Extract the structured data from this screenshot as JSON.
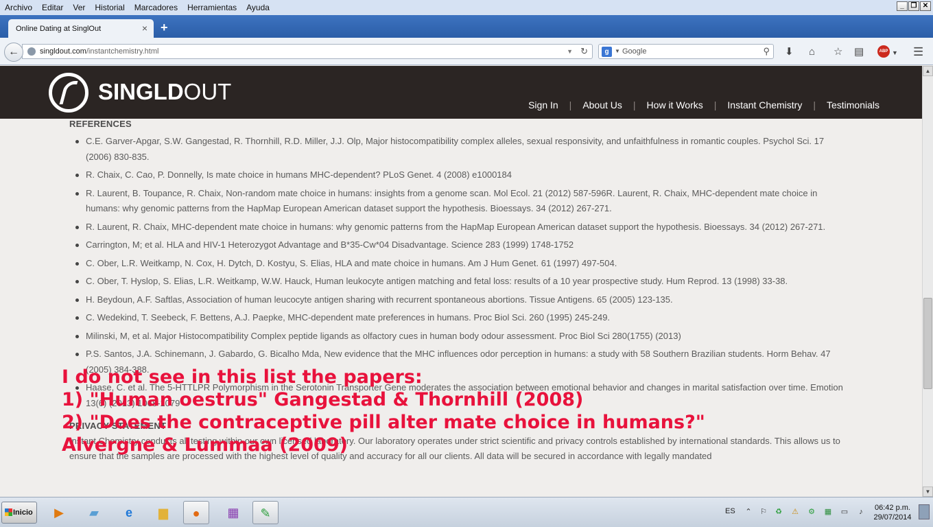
{
  "window": {
    "menu": [
      "Archivo",
      "Editar",
      "Ver",
      "Historial",
      "Marcadores",
      "Herramientas",
      "Ayuda"
    ],
    "controls": {
      "minimize": "_",
      "restore": "❐",
      "close": "✕"
    }
  },
  "tab": {
    "title": "Online Dating at SinglOut",
    "close_label": "×",
    "new_tab_label": "+"
  },
  "navbar": {
    "back_label": "←",
    "url_host": "singldout.com",
    "url_path": "/instantchemistry.html",
    "search_engine_label": "g",
    "search_placeholder": "Google",
    "icons": [
      "download-icon",
      "home-icon",
      "bookmark-star-icon",
      "reading-list-icon",
      "adblock-icon",
      "menu-icon"
    ],
    "abp_label": "ABP"
  },
  "site": {
    "logo_text_bold": "SINGLD",
    "logo_text_light": "OUT",
    "nav": [
      "Sign In",
      "About Us",
      "How it Works",
      "Instant Chemistry",
      "Testimonials"
    ],
    "separator": "|"
  },
  "content": {
    "references_title": "REFERENCES",
    "references": [
      "C.E. Garver-Apgar, S.W. Gangestad, R. Thornhill, R.D. Miller, J.J. Olp, Major histocompatibility complex alleles, sexual responsivity, and unfaithfulness in romantic couples. Psychol Sci. 17 (2006) 830-835.",
      "R. Chaix, C. Cao, P. Donnelly, Is mate choice in humans MHC-dependent? PLoS Genet. 4 (2008) e1000184",
      "R. Laurent, B. Toupance, R. Chaix, Non-random mate choice in humans: insights from a genome scan. Mol Ecol. 21 (2012) 587-596R. Laurent, R. Chaix, MHC-dependent mate choice in humans: why genomic patterns from the HapMap European American dataset support the hypothesis. Bioessays. 34 (2012) 267-271.",
      "R. Laurent, R. Chaix, MHC-dependent mate choice in humans: why genomic patterns from the HapMap European American dataset support the hypothesis. Bioessays. 34 (2012) 267-271.",
      "Carrington, M; et al. HLA and HIV-1 Heterozygot Advantage and B*35-Cw*04 Disadvantage. Science 283 (1999) 1748-1752",
      "C. Ober, L.R. Weitkamp, N. Cox, H. Dytch, D. Kostyu, S. Elias, HLA and mate choice in humans. Am J Hum Genet. 61 (1997) 497-504.",
      "C. Ober, T. Hyslop, S. Elias, L.R. Weitkamp, W.W. Hauck, Human leukocyte antigen matching and fetal loss: results of a 10 year prospective study. Hum Reprod. 13 (1998) 33-38.",
      "H. Beydoun, A.F. Saftlas, Association of human leucocyte antigen sharing with recurrent spontaneous abortions. Tissue Antigens. 65 (2005) 123-135.",
      "C. Wedekind, T. Seebeck, F. Bettens, A.J. Paepke, MHC-dependent mate preferences in humans. Proc Biol Sci. 260 (1995) 245-249.",
      "Milinski, M, et al. Major Histocompatibility Complex peptide ligands as olfactory cues in human body odour assessment. Proc Biol Sci 280(1755) (2013)",
      "P.S. Santos, J.A. Schinemann, J. Gabardo, G. Bicalho Mda, New evidence that the MHC influences odor perception in humans: a study with 58 Southern Brazilian students. Horm Behav. 47 (2005) 384-388.",
      "Haase, C. et al. The 5-HTTLPR Polymorphism in the Serotonin Transporter Gene moderates the association between emotional behavior and changes in marital satisfaction over time. Emotion 13(6) (2013) 1068-1079"
    ],
    "privacy_title": "PRIVACY STATEMENT",
    "privacy_text": "Instant Chemistry conducts all testing within our own licensed laboratory. Our laboratory operates under strict scientific and privacy controls established by international standards. This allows us to ensure that the samples are processed with the highest level of quality and accuracy for all our clients. All data will be secured in accordance with legally mandated"
  },
  "annotation": {
    "line1": "I do not see in this list the papers:",
    "line2": "1) \"Human oestrus\" Gangestad & Thornhill (2008)",
    "line3": "2) \"Does the contraceptive pill alter mate choice in humans?\"",
    "line4": "Alvergne & Lummaa (2009)",
    "color": "#e8123c"
  },
  "taskbar": {
    "start_label": "Inicio",
    "apps": [
      "media-player-icon",
      "notepad-icon",
      "internet-explorer-icon",
      "folder-icon",
      "firefox-icon",
      "tiles-app-icon",
      "pen-tool-icon"
    ],
    "language": "ES",
    "time": "06:42 p.m.",
    "date": "29/07/2014"
  }
}
